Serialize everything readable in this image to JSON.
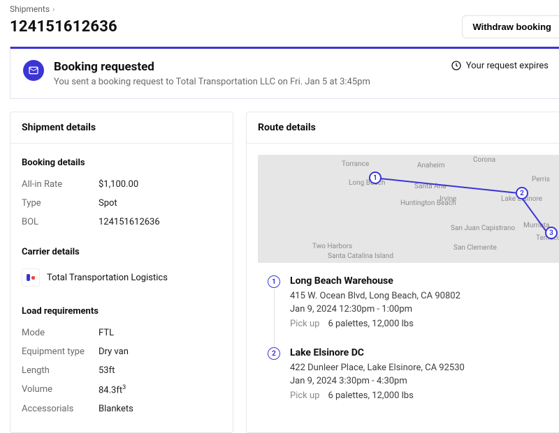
{
  "breadcrumb": {
    "parent": "Shipments"
  },
  "title": "124151612636",
  "actions": {
    "withdraw_label": "Withdraw booking"
  },
  "banner": {
    "title": "Booking requested",
    "subtitle": "You sent a booking request to Total Transportation LLC on Fri. Jan 5 at 3:45pm",
    "expiry_prefix": "Your request expires"
  },
  "shipment_card": {
    "header": "Shipment details",
    "booking": {
      "title": "Booking details",
      "rows": {
        "rate_k": "All-in Rate",
        "rate_v": "$1,100.00",
        "type_k": "Type",
        "type_v": "Spot",
        "bol_k": "BOL",
        "bol_v": "124151612636"
      }
    },
    "carrier": {
      "title": "Carrier details",
      "name": "Total Transportation Logistics"
    },
    "load": {
      "title": "Load requirements",
      "rows": {
        "mode_k": "Mode",
        "mode_v": "FTL",
        "equip_k": "Equipment type",
        "equip_v": "Dry van",
        "len_k": "Length",
        "len_v": "53ft",
        "vol_k": "Volume",
        "vol_v_num": "84.3ft",
        "vol_v_sup": "3",
        "acc_k": "Accessorials",
        "acc_v": "Blankets"
      }
    }
  },
  "route_card": {
    "header": "Route details",
    "map_labels": {
      "torrance": "Torrance",
      "anaheim": "Anaheim",
      "corona": "Corona",
      "longbeach": "Long Beach",
      "santaana": "Santa Ana",
      "perris": "Perris",
      "lakeelsinore": "Lake Elsinore",
      "huntington": "Huntington Beach",
      "irvine": "Irvine",
      "murrieta": "Murrieta",
      "temecula": "Temecula",
      "sanjuan": "San Juan Capistrano",
      "sanclemente": "San Clemente",
      "twoharbors": "Two Harbors",
      "catalina": "Santa Catalina Island"
    },
    "stops": [
      {
        "num": "1",
        "name": "Long Beach Warehouse",
        "address": "415 W. Ocean Blvd, Long Beach, CA 90802",
        "time": "Jan 9, 2024 12:30pm - 1:00pm",
        "tag": "Pick up",
        "meta": "6 palettes, 12,000 lbs"
      },
      {
        "num": "2",
        "name": "Lake Elsinore DC",
        "address": "422 Dunleer Place, Lake Elsinore, CA 92530",
        "time": "Jan 9, 2024 3:30pm - 4:30pm",
        "tag": "Pick up",
        "meta": "6 palettes, 12,000 lbs"
      }
    ]
  }
}
